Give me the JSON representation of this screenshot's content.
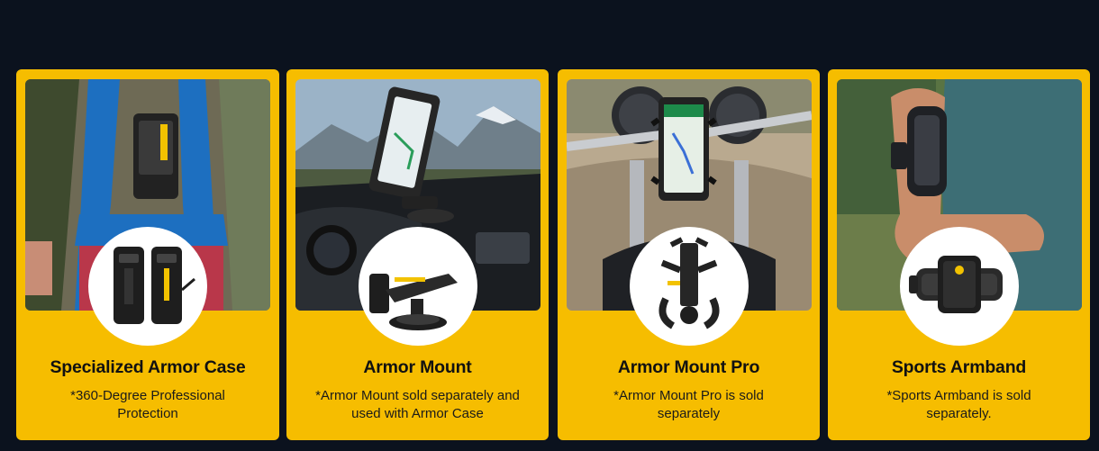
{
  "cards": [
    {
      "title": "Specialized Armor Case",
      "note": "*360-Degree Professional Protection",
      "photo_icon": "hiker-wearing-armor-case",
      "product_icon": "armor-case"
    },
    {
      "title": "Armor Mount",
      "note": "*Armor Mount sold separately and used with Armor Case",
      "photo_icon": "car-dashboard-phone-mount",
      "product_icon": "suction-dash-mount"
    },
    {
      "title": "Armor Mount Pro",
      "note": "*Armor Mount Pro is sold separately",
      "photo_icon": "motorcycle-handlebar-phone-mount",
      "product_icon": "handlebar-claw-mount"
    },
    {
      "title": "Sports Armband",
      "note": "*Sports Armband is sold separately.",
      "photo_icon": "runner-arm-with-armband",
      "product_icon": "armband-holder"
    }
  ],
  "colors": {
    "page_background": "#0b121e",
    "card_background": "#f6bd00",
    "circle_background": "#ffffff",
    "title_text": "#111111"
  }
}
